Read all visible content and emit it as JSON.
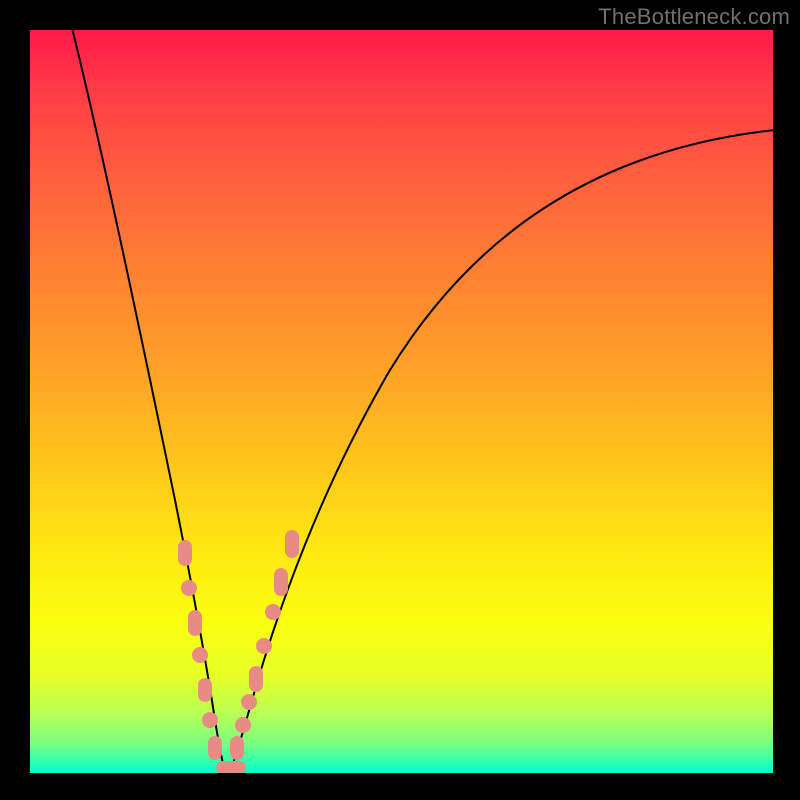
{
  "watermark": "TheBottleneck.com",
  "colors": {
    "frame": "#000000",
    "curve": "#000000",
    "marker": "#e88b85",
    "gradient_top": "#ff1a4a",
    "gradient_bottom": "#00ffd0"
  },
  "chart_data": {
    "type": "line",
    "title": "",
    "xlabel": "",
    "ylabel": "",
    "xlim": [
      0,
      100
    ],
    "ylim": [
      0,
      100
    ],
    "grid": false,
    "legend": false,
    "note": "Axes are unlabeled in the source image; values below are positional estimates (0–100) read from the plot area.",
    "series": [
      {
        "name": "left-branch",
        "x": [
          5,
          8,
          11,
          14,
          17,
          19,
          21,
          22,
          23,
          24,
          25
        ],
        "y": [
          100,
          86,
          72,
          58,
          44,
          34,
          24,
          16,
          10,
          5,
          0
        ]
      },
      {
        "name": "right-branch",
        "x": [
          27,
          29,
          32,
          36,
          41,
          48,
          56,
          66,
          78,
          90,
          100
        ],
        "y": [
          0,
          6,
          16,
          28,
          40,
          52,
          62,
          71,
          78,
          83,
          86
        ]
      }
    ],
    "markers": [
      {
        "series": "left-branch",
        "x": 20.5,
        "y": 29,
        "shape": "pill"
      },
      {
        "series": "left-branch",
        "x": 21.2,
        "y": 24,
        "shape": "dot"
      },
      {
        "series": "left-branch",
        "x": 22.0,
        "y": 19,
        "shape": "pill"
      },
      {
        "series": "left-branch",
        "x": 22.8,
        "y": 14,
        "shape": "dot"
      },
      {
        "series": "left-branch",
        "x": 23.4,
        "y": 10,
        "shape": "pill"
      },
      {
        "series": "left-branch",
        "x": 24.0,
        "y": 6,
        "shape": "dot"
      },
      {
        "series": "left-branch",
        "x": 24.8,
        "y": 2,
        "shape": "pill"
      },
      {
        "series": "valley",
        "x": 26.0,
        "y": 0.5,
        "shape": "pill-h"
      },
      {
        "series": "right-branch",
        "x": 27.5,
        "y": 2,
        "shape": "pill"
      },
      {
        "series": "right-branch",
        "x": 28.4,
        "y": 5,
        "shape": "dot"
      },
      {
        "series": "right-branch",
        "x": 29.2,
        "y": 8,
        "shape": "dot"
      },
      {
        "series": "right-branch",
        "x": 30.2,
        "y": 12,
        "shape": "pill"
      },
      {
        "series": "right-branch",
        "x": 31.2,
        "y": 16,
        "shape": "dot"
      },
      {
        "series": "right-branch",
        "x": 32.4,
        "y": 21,
        "shape": "dot"
      },
      {
        "series": "right-branch",
        "x": 33.8,
        "y": 26,
        "shape": "pill"
      },
      {
        "series": "right-branch",
        "x": 35.2,
        "y": 31,
        "shape": "pill"
      }
    ]
  }
}
